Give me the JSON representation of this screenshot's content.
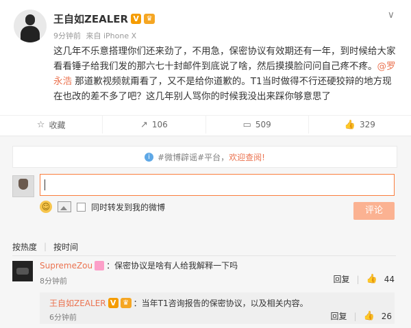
{
  "post": {
    "author": "王自如ZEALER",
    "verify_badge": "V",
    "crown_badge": "♛",
    "time": "9分钟前",
    "source": "来自 iPhone X",
    "more": "∨",
    "text_part1": "这几年不乐意搭理你们还来劲了，不用急，保密协议有效期还有一年，到时候给大家看看锤子给我们发的那六七十封邮件到底说了啥，然后摸摸脸问问自己疼不疼。",
    "mention": "@罗永浩",
    "text_part2": " 那道歉视频就甭看了，又不是给你道歉的。T1当时做得不行还硬狡辩的地方现在也改的差不多了吧？这几年别人骂你的时候我没出来踩你够意思了"
  },
  "actions": [
    {
      "icon": "star-icon",
      "glyph": "☆",
      "label": "收藏"
    },
    {
      "icon": "share-icon",
      "glyph": "↗",
      "label": "106"
    },
    {
      "icon": "comment-icon",
      "glyph": "▭",
      "label": "509"
    },
    {
      "icon": "like-icon",
      "glyph": "👍",
      "label": "329"
    }
  ],
  "comment_box": {
    "notice_prefix": "#微博辟谣#平台，",
    "notice_link": "欢迎查阅!",
    "repost_label": "同时转发到我的微博",
    "submit_label": "评论"
  },
  "sort": {
    "hot": "按热度",
    "time": "按时间"
  },
  "comments": [
    {
      "user": "SupremeZou",
      "text": "：保密协议是啥有人给我解释一下吗",
      "time": "8分钟前",
      "reply_label": "回复",
      "likes": "44"
    }
  ],
  "reply": {
    "user": "王自如ZEALER",
    "text": "：当年T1咨询报告的保密协议，以及相关内容。",
    "time": "6分钟前",
    "reply_label": "回复",
    "likes": "26"
  },
  "colors": {
    "accent": "#eb7350",
    "input_border": "#fa7d3c",
    "submit_bg": "#fbb292"
  }
}
